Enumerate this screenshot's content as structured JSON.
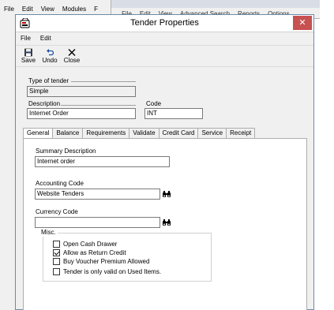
{
  "background": {
    "menu1": [
      "File",
      "Edit",
      "View",
      "Modules",
      "F"
    ],
    "menu2": [
      "File",
      "Edit",
      "View",
      "Advanced Search",
      "Reports",
      "Options"
    ]
  },
  "dialog": {
    "title": "Tender Properties",
    "close_glyph": "✕",
    "menu": [
      "File",
      "Edit"
    ],
    "toolbar": {
      "save": "Save",
      "undo": "Undo",
      "close": "Close"
    },
    "type_of_tender": {
      "label": "Type of tender",
      "value": "Simple"
    },
    "description": {
      "label": "Description",
      "value": "Internet Order"
    },
    "code": {
      "label": "Code",
      "value": "INT"
    },
    "tabs": [
      "General",
      "Balance",
      "Requirements",
      "Validate",
      "Credit Card",
      "Service",
      "Receipt"
    ],
    "active_tab": "General",
    "general": {
      "summary_description": {
        "label": "Summary Description",
        "value": "Internet order"
      },
      "accounting_code": {
        "label": "Accounting Code",
        "value": "Website Tenders"
      },
      "currency_code": {
        "label": "Currency Code",
        "value": ""
      },
      "misc": {
        "title": "Misc.",
        "options": [
          {
            "label": "Open Cash Drawer",
            "checked": false
          },
          {
            "label": "Allow as Return Credit",
            "checked": true
          },
          {
            "label": "Buy Voucher Premium Allowed",
            "checked": false
          },
          {
            "label": "Tender is only valid on Used Items.",
            "checked": false
          }
        ]
      }
    }
  },
  "colors": {
    "close_button": "#c75050",
    "dialog_border": "#6e8aa8"
  }
}
